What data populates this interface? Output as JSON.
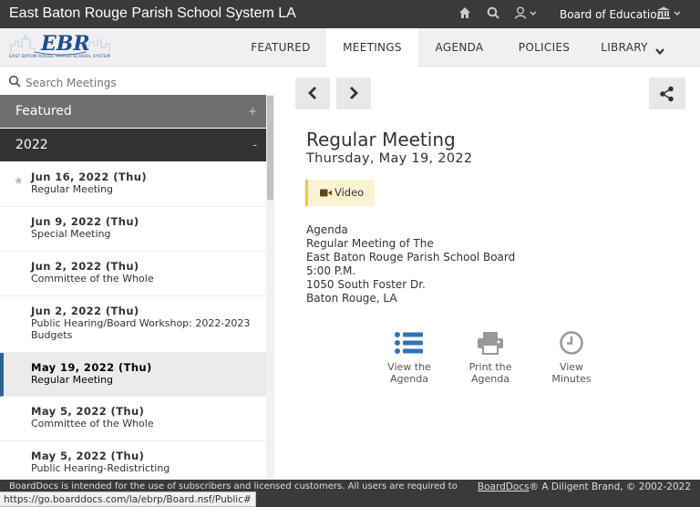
{
  "topbar": {
    "title": "East Baton Rouge Parish School System LA",
    "board_label": "Board of Education"
  },
  "logo": {
    "mark": "EBR",
    "subtitle": "EAST BATON ROUGE PARISH SCHOOL SYSTEM"
  },
  "nav": {
    "items": [
      "FEATURED",
      "MEETINGS",
      "AGENDA",
      "POLICIES",
      "LIBRARY"
    ],
    "active": "MEETINGS"
  },
  "search": {
    "placeholder": "Search Meetings"
  },
  "sidebar": {
    "sections": [
      {
        "label": "Featured",
        "toggle": "+"
      },
      {
        "label": "2022",
        "toggle": "-"
      }
    ],
    "meetings": [
      {
        "date": "Jun 16, 2022 (Thu)",
        "title": "Regular Meeting"
      },
      {
        "date": "Jun 9, 2022 (Thu)",
        "title": "Special Meeting"
      },
      {
        "date": "Jun 2, 2022 (Thu)",
        "title": "Committee of the Whole"
      },
      {
        "date": "Jun 2, 2022 (Thu)",
        "title_line1": "Public Hearing/Board Workshop: 2022-2023",
        "title_line2": "Budgets"
      },
      {
        "date": "May 19, 2022 (Thu)",
        "title": "Regular Meeting",
        "selected": true
      },
      {
        "date": "May 5, 2022 (Thu)",
        "title": "Committee of the Whole"
      },
      {
        "date": "May 5, 2022 (Thu)",
        "title": "Public Hearing-Redistricting"
      }
    ]
  },
  "meeting": {
    "title": "Regular Meeting",
    "date": "Thursday, May 19, 2022",
    "video_label": "Video",
    "agenda_lines": [
      "Agenda",
      "Regular Meeting of The",
      "East Baton Rouge Parish School Board",
      "5:00 P.M.",
      "1050 South Foster Dr.",
      "Baton Rouge, LA"
    ],
    "actions": [
      {
        "line1": "View the",
        "line2": "Agenda",
        "icon": "list-icon"
      },
      {
        "line1": "Print the",
        "line2": "Agenda",
        "icon": "printer-icon"
      },
      {
        "line1": "View",
        "line2": "Minutes",
        "icon": "clock-icon"
      }
    ]
  },
  "footer": {
    "left_text": "BoardDocs is intended for the use of subscribers and licensed customers. All users are required to",
    "right_link": "BoardDocs",
    "right_text": "® A Diligent Brand, © 2002-2022"
  },
  "status_url": "https://go.boarddocs.com/la/ebrp/Board.nsf/Public#",
  "colors": {
    "topbar": "#3a3a3a",
    "featured_bg": "#6f6f6f",
    "year_bg": "#333333",
    "selected_accent": "#2a6496",
    "icon_blue": "#3474b3",
    "video_bg": "#fcf3d3"
  }
}
